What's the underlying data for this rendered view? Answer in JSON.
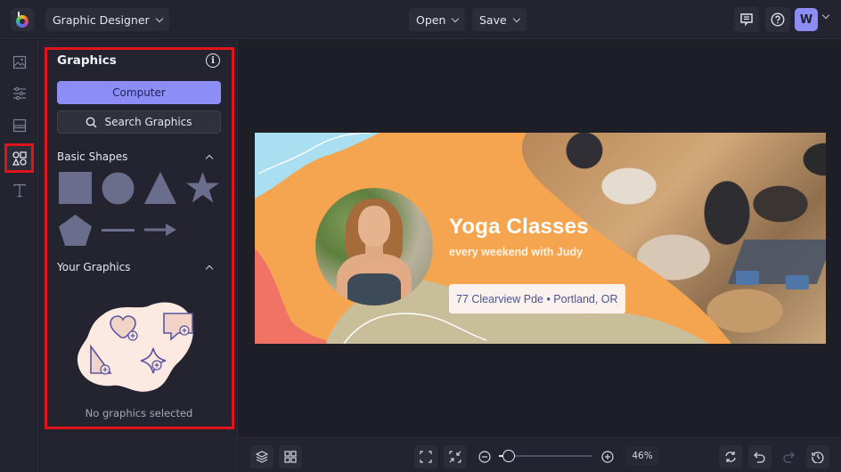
{
  "topbar": {
    "app_mode_label": "Graphic Designer",
    "open_label": "Open",
    "save_label": "Save",
    "avatar_initial": "W",
    "icons": [
      "logo",
      "comments-icon",
      "help-icon",
      "account-chevron-icon"
    ]
  },
  "rail": {
    "items": [
      {
        "name": "image",
        "active": false
      },
      {
        "name": "adjustments",
        "active": false
      },
      {
        "name": "layout",
        "active": false
      },
      {
        "name": "graphics",
        "active": true
      },
      {
        "name": "text",
        "active": false
      }
    ]
  },
  "panel": {
    "title": "Graphics",
    "computer_button": "Computer",
    "search_button": "Search Graphics",
    "basic_shapes_label": "Basic Shapes",
    "shapes": [
      "square",
      "circle",
      "triangle",
      "star",
      "pentagon",
      "line",
      "arrow"
    ],
    "your_graphics_label": "Your Graphics",
    "empty_message": "No graphics selected"
  },
  "design": {
    "headline": "Yoga Classes",
    "subheadline": "every weekend with Judy",
    "address": "77 Clearview Pde • Portland, OR",
    "colors": {
      "orange": "#f5a54f",
      "blue": "#a9dff0",
      "coral": "#f07366",
      "khaki": "#c8bf9a"
    }
  },
  "bottombar": {
    "zoom_percent_label": "46%",
    "zoom_fraction": 0.1,
    "tools": [
      "layers",
      "grid",
      "fit-screen",
      "shrink",
      "zoom-out",
      "zoom-in",
      "replace",
      "undo",
      "redo",
      "history"
    ]
  },
  "accent": {
    "primary": "#8c8ef6",
    "highlight": "#e0141b"
  }
}
